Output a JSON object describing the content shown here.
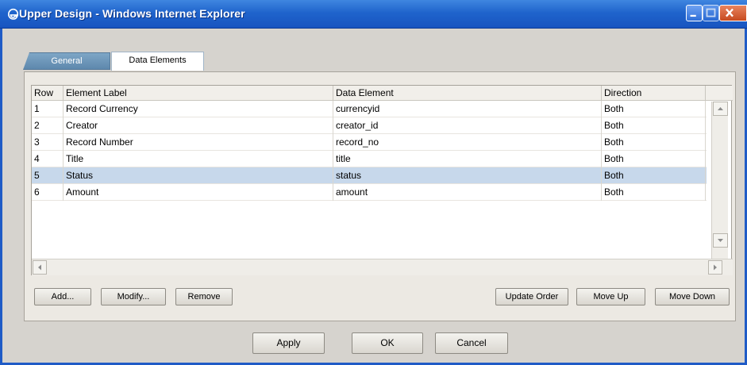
{
  "window": {
    "title": "Upper Design - Windows Internet Explorer"
  },
  "tabs": [
    {
      "label": "General"
    },
    {
      "label": "Data Elements"
    }
  ],
  "grid": {
    "columns": [
      "Row",
      "Element Label",
      "Data Element",
      "Direction"
    ],
    "rows": [
      {
        "row": "1",
        "label": "Record Currency",
        "element": "currencyid",
        "direction": "Both"
      },
      {
        "row": "2",
        "label": "Creator",
        "element": "creator_id",
        "direction": "Both"
      },
      {
        "row": "3",
        "label": "Record Number",
        "element": "record_no",
        "direction": "Both"
      },
      {
        "row": "4",
        "label": "Title",
        "element": "title",
        "direction": "Both"
      },
      {
        "row": "5",
        "label": "Status",
        "element": "status",
        "direction": "Both"
      },
      {
        "row": "6",
        "label": "Amount",
        "element": "amount",
        "direction": "Both"
      }
    ]
  },
  "buttons": {
    "add": "Add...",
    "modify": "Modify...",
    "remove": "Remove",
    "update_order": "Update Order",
    "move_up": "Move Up",
    "move_down": "Move Down",
    "apply": "Apply",
    "ok": "OK",
    "cancel": "Cancel"
  },
  "icons": {
    "title": "ie-logo-icon",
    "minimize": "minimize-icon",
    "maximize": "maximize-icon",
    "close": "close-icon"
  }
}
